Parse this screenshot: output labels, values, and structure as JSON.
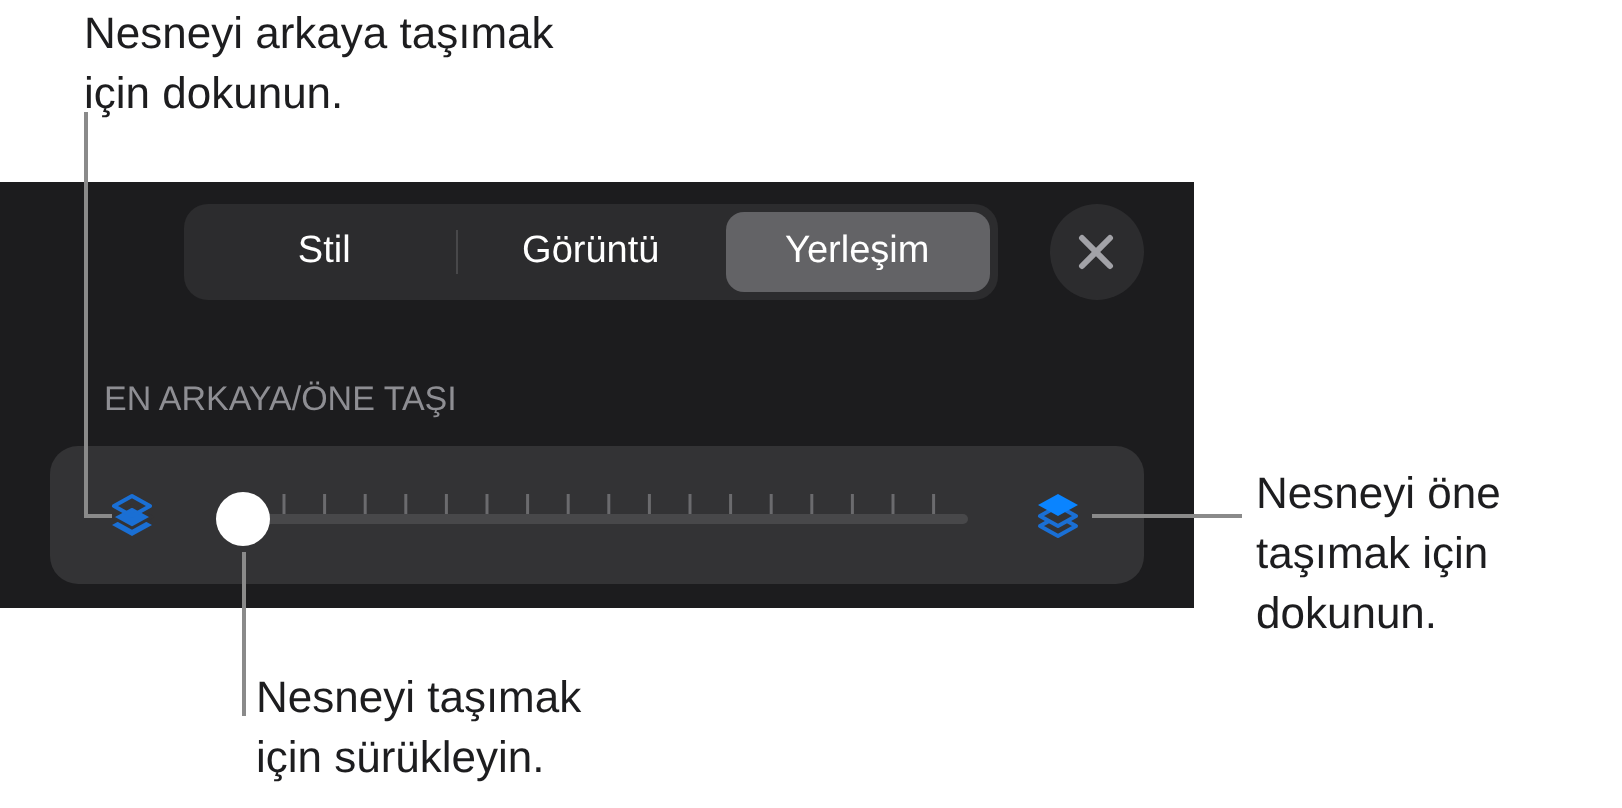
{
  "callouts": [
    {
      "kind": "back",
      "text": "Nesneyi arkaya taşımak\niçin dokunun."
    },
    {
      "kind": "front",
      "text": "Nesneyi öne\ntaşımak için\ndokunun."
    },
    {
      "kind": "thumb",
      "text": "Nesneyi taşımak\niçin sürükleyin."
    }
  ],
  "tabs": [
    {
      "label": "Stil",
      "selected": false
    },
    {
      "label": "Görüntü",
      "selected": false
    },
    {
      "label": "Yerleşim",
      "selected": true
    }
  ],
  "section_label": "EN ARKAYA/ÖNE TAŞI",
  "slider": {
    "level": 0
  }
}
